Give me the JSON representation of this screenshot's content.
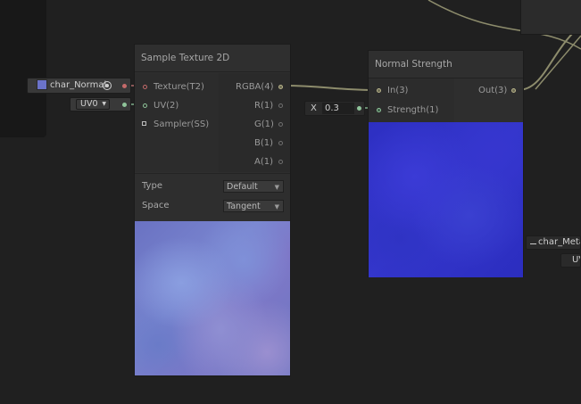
{
  "texture_input": {
    "name": "char_Normal",
    "icon": "texture-swatch-icon"
  },
  "uv_input": {
    "value": "UV0"
  },
  "float_input": {
    "axis": "X",
    "value": "0.3"
  },
  "sample_texture_node": {
    "title": "Sample Texture 2D",
    "inputs": [
      "Texture(T2)",
      "UV(2)",
      "Sampler(SS)"
    ],
    "outputs": [
      "RGBA(4)",
      "R(1)",
      "G(1)",
      "B(1)",
      "A(1)"
    ],
    "type_label": "Type",
    "type_value": "Default",
    "space_label": "Space",
    "space_value": "Tangent"
  },
  "normal_strength_node": {
    "title": "Normal Strength",
    "inputs": [
      "In(3)",
      "Strength(1)"
    ],
    "outputs": [
      "Out(3)"
    ]
  },
  "right_texture_input": {
    "name": "char_Meta"
  },
  "right_uv_input": {
    "value": "UV"
  },
  "colors": {
    "canvas": "#202020",
    "node": "#2e2e2e",
    "wire": "#8d8c6c",
    "normal_preview": "#7a86d0",
    "strength_preview": "#3436cc"
  }
}
